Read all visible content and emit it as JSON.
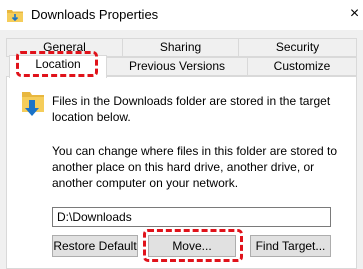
{
  "window": {
    "title": "Downloads Properties",
    "close_glyph": "×"
  },
  "tabs": {
    "row1": [
      "General",
      "Sharing",
      "Security"
    ],
    "row2": [
      "Location",
      "Previous Versions",
      "Customize"
    ],
    "active": "Location"
  },
  "location": {
    "description_1": "Files in the Downloads folder are stored in the target location below.",
    "description_2": "You can change where files in this folder are stored to another place on this hard drive, another drive, or another computer on your network.",
    "path_value": "D:\\Downloads"
  },
  "buttons": {
    "restore_default": "Restore Default",
    "move": "Move...",
    "find_target": "Find Target..."
  },
  "colors": {
    "highlight": "#e0121a",
    "folder": "#e8b73f",
    "arrow": "#1a73c8"
  }
}
